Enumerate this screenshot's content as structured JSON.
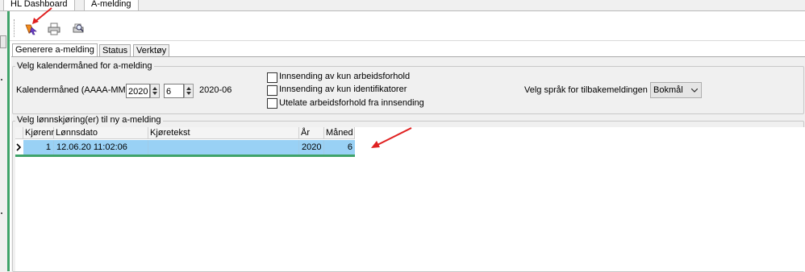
{
  "top_tabs": [
    "HL Dashboard",
    "A-melding"
  ],
  "toolbar": {
    "icons": [
      "run-icon",
      "print-icon",
      "print-preview-icon"
    ]
  },
  "sub_tabs": [
    "Generere a-melding",
    "Status",
    "Verktøy"
  ],
  "period_group": {
    "title": "Velg kalendermåned for a-melding",
    "month_label": "Kalendermåned (AAAA-MM)",
    "year_value": "2020",
    "month_value": "6",
    "result": "2020-06",
    "checkboxes": [
      {
        "label": "Innsending av kun arbeidsforhold",
        "checked": false
      },
      {
        "label": "Innsending av kun identifikatorer",
        "checked": false
      },
      {
        "label": "Utelate arbeidsforhold fra innsending",
        "checked": false
      }
    ],
    "language_label": "Velg språk for tilbakemeldingen",
    "language_value": "Bokmål"
  },
  "payroll_group": {
    "title": "Velg lønnskjøring(er) til ny a-melding",
    "columns": [
      "Kjørenr",
      "Lønnsdato",
      "Kjøretekst",
      "År",
      "Måned"
    ],
    "rows": [
      [
        "1",
        "12.06.20 11:02:06",
        "",
        "2020",
        "6"
      ]
    ]
  },
  "colors": {
    "accent_green": "#3fa36a",
    "selected_row": "#99d1f5",
    "annotation_red": "#e02020"
  }
}
